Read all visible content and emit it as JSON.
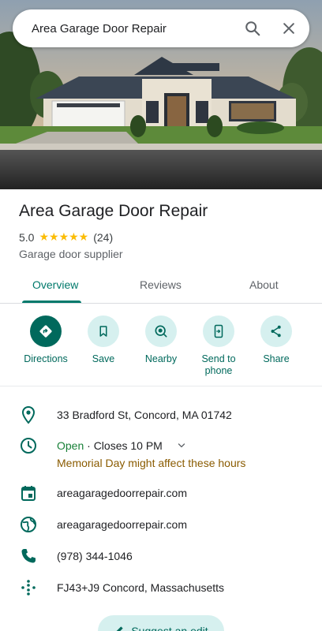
{
  "search": {
    "query": "Area Garage Door Repair"
  },
  "place": {
    "name": "Area Garage Door Repair",
    "rating": "5.0",
    "stars": "★★★★★",
    "review_count": "(24)",
    "category": "Garage door supplier"
  },
  "tabs": [
    {
      "label": "Overview",
      "active": true
    },
    {
      "label": "Reviews",
      "active": false
    },
    {
      "label": "About",
      "active": false
    }
  ],
  "actions": [
    {
      "label": "Directions",
      "icon": "directions-icon"
    },
    {
      "label": "Save",
      "icon": "bookmark-icon"
    },
    {
      "label": "Nearby",
      "icon": "nearby-icon"
    },
    {
      "label": "Send to phone",
      "icon": "send-to-phone-icon"
    },
    {
      "label": "Share",
      "icon": "share-icon"
    }
  ],
  "info": {
    "address": "33 Bradford St, Concord, MA 01742",
    "hours_status": "Open",
    "hours_closes": " · Closes 10 PM",
    "hours_note": "Memorial Day might affect these hours",
    "booking_site": "areagaragedoorrepair.com",
    "website": "areagaragedoorrepair.com",
    "phone": "(978) 344-1046",
    "plus_code": "FJ43+J9 Concord, Massachusetts"
  },
  "suggest_edit": "Suggest an edit",
  "colors": {
    "accent": "#00695c",
    "open": "#188038",
    "warning": "#8a5b00",
    "star": "#fbbc04"
  }
}
